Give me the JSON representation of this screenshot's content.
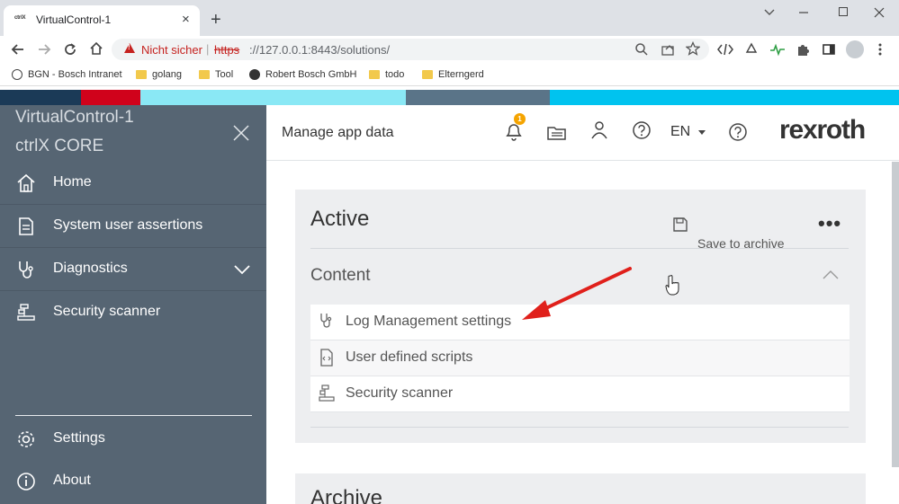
{
  "browser": {
    "tab_title": "VirtualControl-1",
    "tab_favicon_text": "ctrlX",
    "new_tab": "+",
    "tab_close": "×",
    "security_label": "Nicht sicher",
    "url_scheme": "https",
    "url_rest": "://127.0.0.1:8443/solutions/",
    "bookmarks": [
      {
        "label": "BGN - Bosch Intranet",
        "icon": "globe-icon"
      },
      {
        "label": "golang",
        "icon": "folder-icon"
      },
      {
        "label": "Tool",
        "icon": "folder-icon"
      },
      {
        "label": "Robert Bosch GmbH",
        "icon": "github-icon"
      },
      {
        "label": "todo",
        "icon": "folder-icon"
      },
      {
        "label": "Elterngerd",
        "icon": "folder-icon"
      }
    ]
  },
  "stripe_colors": [
    "#1b3a57",
    "#d0021b",
    "#8ae8f5",
    "#5a7488",
    "#00c3ef"
  ],
  "sidebar": {
    "app_name": "VirtualControl-1",
    "product": "ctrlX CORE",
    "items": [
      {
        "label": "Home",
        "icon": "home-icon"
      },
      {
        "label": "System user assertions",
        "icon": "document-icon"
      },
      {
        "label": "Diagnostics",
        "icon": "stethoscope-icon"
      },
      {
        "label": "Security scanner",
        "icon": "scanner-icon"
      }
    ],
    "footer_items": [
      {
        "label": "Settings",
        "icon": "gear-icon"
      },
      {
        "label": "About",
        "icon": "info-icon"
      }
    ]
  },
  "header": {
    "title": "Manage app data",
    "notification_count": "1",
    "language": "EN",
    "brand": "rexroth"
  },
  "active_card": {
    "title": "Active",
    "save_label": "Save to archive",
    "more": "•••",
    "section": "Content",
    "rows": [
      {
        "label": "Log Management settings",
        "icon": "stethoscope-icon"
      },
      {
        "label": "User defined scripts",
        "icon": "script-icon"
      },
      {
        "label": "Security scanner",
        "icon": "scanner-icon"
      }
    ]
  },
  "archive_card": {
    "title": "Archive"
  },
  "colors": {
    "sidebar_bg": "#566573",
    "card_bg": "#edeef0",
    "annotation_arrow": "#e0201b",
    "badge": "#f5a400"
  }
}
